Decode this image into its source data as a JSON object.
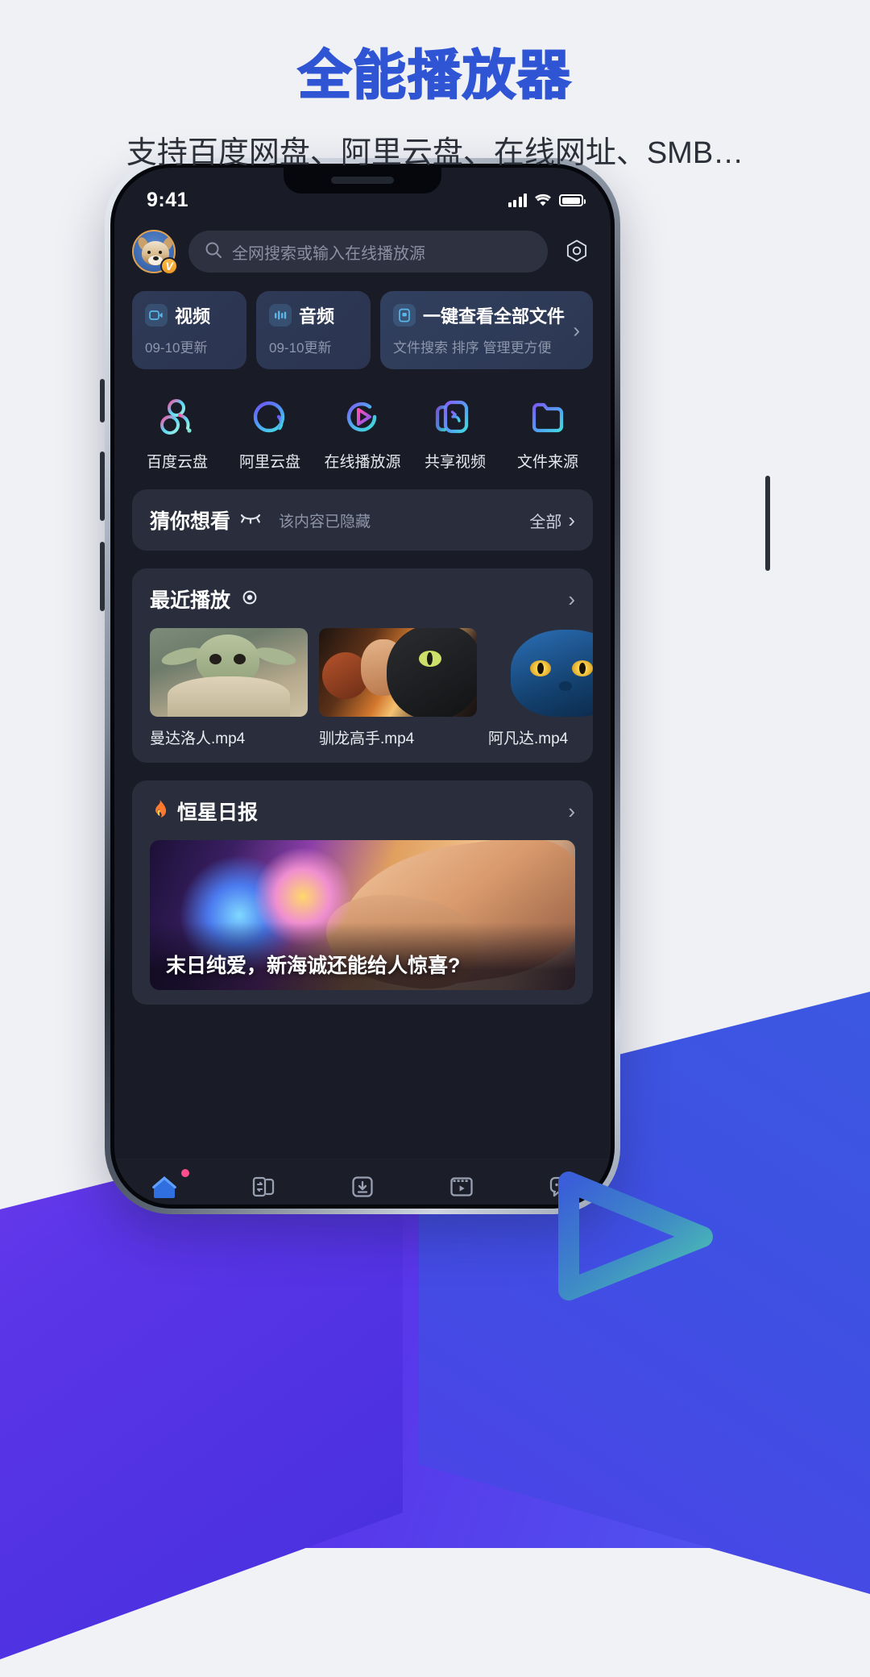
{
  "promo": {
    "headline": "全能播放器",
    "subhead": "支持百度网盘、阿里云盘、在线网址、SMB…"
  },
  "statusbar": {
    "time": "9:41",
    "signal_icon": "cellular-signal-icon",
    "wifi_icon": "wifi-icon",
    "battery_icon": "battery-icon"
  },
  "search": {
    "placeholder": "全网搜索或输入在线播放源",
    "avatar_badge": "V",
    "search_icon": "search-icon",
    "settings_icon": "gear-icon"
  },
  "quick_cards": [
    {
      "title": "视频",
      "sub": "09-10更新",
      "icon": "video-camera-icon"
    },
    {
      "title": "音频",
      "sub": "09-10更新",
      "icon": "audio-wave-icon"
    },
    {
      "title": "一键查看全部文件",
      "sub": "文件搜索 排序 管理更方便",
      "icon": "file-icon",
      "arrow": "›"
    }
  ],
  "shortcuts": [
    {
      "label": "百度云盘",
      "icon": "baidu-cloud-icon"
    },
    {
      "label": "阿里云盘",
      "icon": "aliyun-drive-icon"
    },
    {
      "label": "在线播放源",
      "icon": "online-play-icon"
    },
    {
      "label": "共享视频",
      "icon": "shared-video-icon"
    },
    {
      "label": "文件来源",
      "icon": "file-source-icon"
    }
  ],
  "guess": {
    "title": "猜你想看",
    "eye_icon": "eye-closed-icon",
    "hidden_text": "该内容已隐藏",
    "all_label": "全部",
    "chevron": "›"
  },
  "recent": {
    "title": "最近播放",
    "eye_icon": "eye-open-icon",
    "chevron": "›",
    "items": [
      {
        "name": "曼达洛人.mp4",
        "art": "yoda"
      },
      {
        "name": "驯龙高手.mp4",
        "art": "dragon"
      },
      {
        "name": "阿凡达.mp4",
        "art": "avatar"
      }
    ]
  },
  "daily": {
    "title": "恒星日报",
    "flame_icon": "flame-icon",
    "chevron": "›",
    "banner_caption": "末日纯爱，新海诚还能给人惊喜?"
  },
  "tabbar": [
    {
      "label": "首页",
      "icon": "home-icon",
      "active": true,
      "badge": true
    },
    {
      "label": "共享",
      "icon": "share-icon",
      "active": false,
      "badge": false
    },
    {
      "label": "下载",
      "icon": "download-icon",
      "active": false,
      "badge": false
    },
    {
      "label": "视频",
      "icon": "video-icon",
      "active": false,
      "badge": false
    },
    {
      "label": "消息",
      "icon": "message-icon",
      "active": false,
      "badge": false
    }
  ],
  "colors": {
    "brand_blue": "#2f55d4",
    "accent_blue": "#4b8ef7",
    "badge_pink": "#ff4d8d",
    "vip_orange": "#ef9a22"
  }
}
